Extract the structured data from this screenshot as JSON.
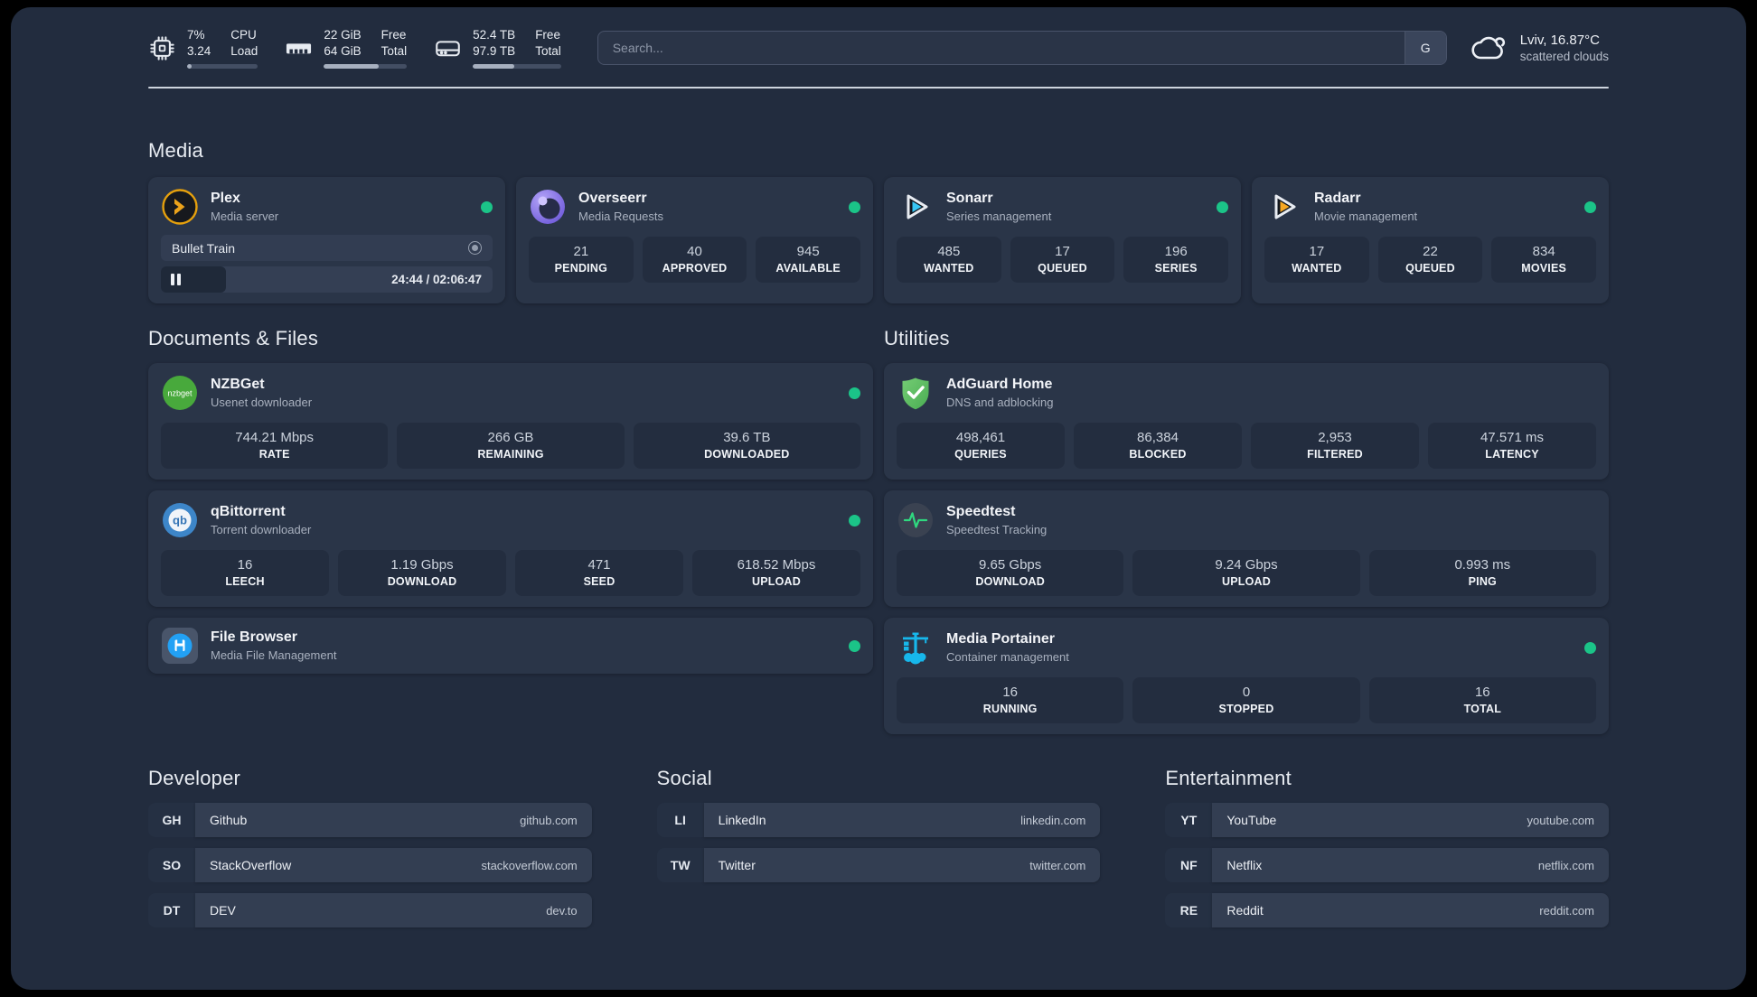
{
  "header": {
    "metrics": {
      "cpu": {
        "value": "7%",
        "total": "3.24",
        "label1": "CPU",
        "label2": "Load",
        "progress": 7
      },
      "ram": {
        "value": "22 GiB",
        "total": "64 GiB",
        "label1": "Free",
        "label2": "Total",
        "progress": 66
      },
      "disk": {
        "value": "52.4 TB",
        "total": "97.9 TB",
        "label1": "Free",
        "label2": "Total",
        "progress": 47
      }
    },
    "search": {
      "placeholder": "Search...",
      "engine_label": "G"
    },
    "weather": {
      "location": "Lviv, 16.87°C",
      "condition": "scattered clouds"
    }
  },
  "media": {
    "title": "Media",
    "plex": {
      "name": "Plex",
      "desc": "Media server",
      "now_playing": "Bullet Train",
      "time": "24:44 / 02:06:47",
      "progress": 19.5
    },
    "overseerr": {
      "name": "Overseerr",
      "desc": "Media Requests",
      "stats": [
        {
          "value": "21",
          "label": "PENDING"
        },
        {
          "value": "40",
          "label": "APPROVED"
        },
        {
          "value": "945",
          "label": "AVAILABLE"
        }
      ]
    },
    "sonarr": {
      "name": "Sonarr",
      "desc": "Series management",
      "stats": [
        {
          "value": "485",
          "label": "WANTED"
        },
        {
          "value": "17",
          "label": "QUEUED"
        },
        {
          "value": "196",
          "label": "SERIES"
        }
      ]
    },
    "radarr": {
      "name": "Radarr",
      "desc": "Movie management",
      "stats": [
        {
          "value": "17",
          "label": "WANTED"
        },
        {
          "value": "22",
          "label": "QUEUED"
        },
        {
          "value": "834",
          "label": "MOVIES"
        }
      ]
    }
  },
  "documents": {
    "title": "Documents & Files",
    "nzbget": {
      "name": "NZBGet",
      "desc": "Usenet downloader",
      "stats": [
        {
          "value": "744.21 Mbps",
          "label": "RATE"
        },
        {
          "value": "266 GB",
          "label": "REMAINING"
        },
        {
          "value": "39.6 TB",
          "label": "DOWNLOADED"
        }
      ]
    },
    "qbittorrent": {
      "name": "qBittorrent",
      "desc": "Torrent downloader",
      "stats": [
        {
          "value": "16",
          "label": "LEECH"
        },
        {
          "value": "1.19 Gbps",
          "label": "DOWNLOAD"
        },
        {
          "value": "471",
          "label": "SEED"
        },
        {
          "value": "618.52 Mbps",
          "label": "UPLOAD"
        }
      ]
    },
    "filebrowser": {
      "name": "File Browser",
      "desc": "Media File Management"
    }
  },
  "utilities": {
    "title": "Utilities",
    "adguard": {
      "name": "AdGuard Home",
      "desc": "DNS and adblocking",
      "stats": [
        {
          "value": "498,461",
          "label": "QUERIES"
        },
        {
          "value": "86,384",
          "label": "BLOCKED"
        },
        {
          "value": "2,953",
          "label": "FILTERED"
        },
        {
          "value": "47.571 ms",
          "label": "LATENCY"
        }
      ]
    },
    "speedtest": {
      "name": "Speedtest",
      "desc": "Speedtest Tracking",
      "stats": [
        {
          "value": "9.65 Gbps",
          "label": "DOWNLOAD"
        },
        {
          "value": "9.24 Gbps",
          "label": "UPLOAD"
        },
        {
          "value": "0.993 ms",
          "label": "PING"
        }
      ]
    },
    "portainer": {
      "name": "Media Portainer",
      "desc": "Container management",
      "stats": [
        {
          "value": "16",
          "label": "RUNNING"
        },
        {
          "value": "0",
          "label": "STOPPED"
        },
        {
          "value": "16",
          "label": "TOTAL"
        }
      ]
    }
  },
  "bookmarks": {
    "developer": {
      "title": "Developer",
      "items": [
        {
          "abbr": "GH",
          "name": "Github",
          "url": "github.com"
        },
        {
          "abbr": "SO",
          "name": "StackOverflow",
          "url": "stackoverflow.com"
        },
        {
          "abbr": "DT",
          "name": "DEV",
          "url": "dev.to"
        }
      ]
    },
    "social": {
      "title": "Social",
      "items": [
        {
          "abbr": "LI",
          "name": "LinkedIn",
          "url": "linkedin.com"
        },
        {
          "abbr": "TW",
          "name": "Twitter",
          "url": "twitter.com"
        }
      ]
    },
    "entertainment": {
      "title": "Entertainment",
      "items": [
        {
          "abbr": "YT",
          "name": "YouTube",
          "url": "youtube.com"
        },
        {
          "abbr": "NF",
          "name": "Netflix",
          "url": "netflix.com"
        },
        {
          "abbr": "RE",
          "name": "Reddit",
          "url": "reddit.com"
        }
      ]
    }
  },
  "colors": {
    "status_green": "#1bc488",
    "plex_amber": "#e5a00d",
    "sonarr_cyan": "#38c6f4",
    "radarr_amber": "#f7a823",
    "nzbget_green": "#48a93c",
    "qbittorrent_blue": "#3d86c9",
    "adguard_green": "#5fbf5f",
    "speedtest_green": "#2fd87f",
    "portainer_blue": "#17b7eb",
    "filebrowser_blue": "#22a1f5",
    "overseerr_purple": "#8b79ee"
  }
}
